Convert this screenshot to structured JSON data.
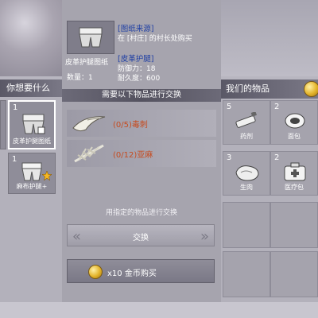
{
  "left_panel": {
    "title": "你想要什么",
    "slots": [
      {
        "count": "1",
        "label": "皮革护腿图纸",
        "selected": true
      },
      {
        "count": "1",
        "label": "麻布护腿+",
        "selected": false
      }
    ]
  },
  "item_info": {
    "name": "皮革护腿图纸",
    "quantity_label": "数量：1",
    "source_header": "[图纸来源]",
    "source_text": "在 [村庄] 的村长处购买",
    "ability_header": "[皮革护腿]",
    "defense_text": "防御力：18",
    "durability_text": "耐久度：600"
  },
  "requirements": {
    "title": "需要以下物品进行交换",
    "items": [
      {
        "text": "(0/5)毒刺"
      },
      {
        "text": "(0/12)亚麻"
      }
    ]
  },
  "hint_text": "用指定的物品进行交换",
  "exchange_button": {
    "label": "交换"
  },
  "buy_button": {
    "label": "x10 金币购买"
  },
  "right_panel": {
    "title": "我们的物品",
    "items": [
      {
        "count": "5",
        "name": "药剂"
      },
      {
        "count": "2",
        "name": "面包"
      },
      {
        "count": "3",
        "name": "生肉"
      },
      {
        "count": "2",
        "name": "医疗包"
      }
    ]
  },
  "colors": {
    "requirement_text": "#c64b1f",
    "section_header": "#1f3fa4"
  }
}
